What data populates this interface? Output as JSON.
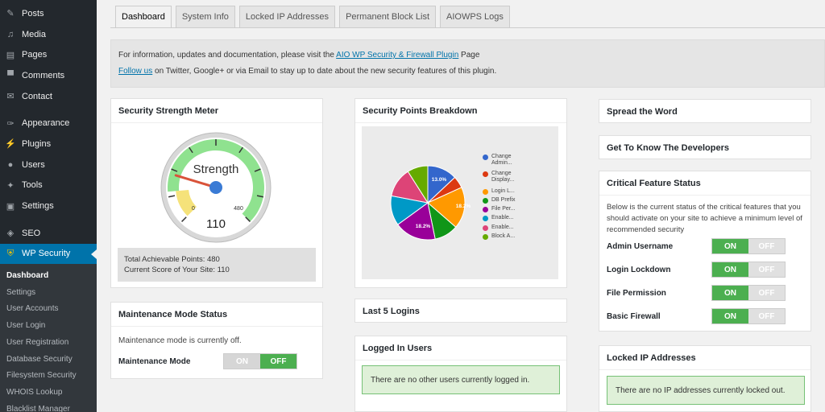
{
  "sidebar": {
    "menu": [
      {
        "label": "Posts",
        "icon": "pin-icon"
      },
      {
        "label": "Media",
        "icon": "media-icon"
      },
      {
        "label": "Pages",
        "icon": "pages-icon"
      },
      {
        "label": "Comments",
        "icon": "comment-icon"
      },
      {
        "label": "Contact",
        "icon": "mail-icon"
      },
      {
        "label": "Appearance",
        "icon": "brush-icon"
      },
      {
        "label": "Plugins",
        "icon": "plug-icon"
      },
      {
        "label": "Users",
        "icon": "user-icon"
      },
      {
        "label": "Tools",
        "icon": "wrench-icon"
      },
      {
        "label": "Settings",
        "icon": "settings-icon"
      },
      {
        "label": "SEO",
        "icon": "seo-icon"
      },
      {
        "label": "WP Security",
        "icon": "shield-icon"
      }
    ],
    "submenu": [
      "Dashboard",
      "Settings",
      "User Accounts",
      "User Login",
      "User Registration",
      "Database Security",
      "Filesystem Security",
      "WHOIS Lookup",
      "Blacklist Manager"
    ]
  },
  "tabs": [
    "Dashboard",
    "System Info",
    "Locked IP Addresses",
    "Permanent Block List",
    "AIOWPS Logs"
  ],
  "info": {
    "line1_pre": "For information, updates and documentation, please visit the ",
    "line1_link": "AIO WP Security & Firewall Plugin",
    "line1_post": " Page",
    "line2_link": "Follow us",
    "line2_post": " on Twitter, Google+ or via Email to stay up to date about the new security features of this plugin."
  },
  "meter": {
    "title": "Security Strength Meter",
    "gauge_label": "Strength",
    "min": "0",
    "max": "480",
    "value": "110",
    "value_num": 110,
    "max_num": 480,
    "total_label": "Total Achievable Points: 480",
    "current_label": "Current Score of Your Site: 110"
  },
  "breakdown": {
    "title": "Security Points Breakdown",
    "legend": [
      {
        "l1": "Change",
        "l2": "Admin...",
        "color": "#3366cc"
      },
      {
        "l1": "Change",
        "l2": "Display...",
        "color": "#dc3912"
      },
      {
        "l1": "Login L...",
        "l2": "",
        "color": "#ff9900"
      },
      {
        "l1": "DB Prefix",
        "l2": "",
        "color": "#109618"
      },
      {
        "l1": "File Per...",
        "l2": "",
        "color": "#990099"
      },
      {
        "l1": "Enable...",
        "l2": "",
        "color": "#0099c6"
      },
      {
        "l1": "Enable...",
        "l2": "",
        "color": "#dd4477"
      },
      {
        "l1": "Block A...",
        "l2": "",
        "color": "#66aa00"
      }
    ],
    "slice_labels": [
      "13.0%",
      "18.2%",
      "18.2%"
    ]
  },
  "chart_data": {
    "type": "pie",
    "categories": [
      "Change Admin...",
      "Change Display...",
      "Login L...",
      "DB Prefix",
      "File Per...",
      "Enable...",
      "Enable...",
      "Block A..."
    ],
    "values": [
      13.0,
      5.2,
      18.2,
      10.4,
      18.2,
      13.0,
      13.0,
      9.0
    ],
    "colors": [
      "#3366cc",
      "#dc3912",
      "#ff9900",
      "#109618",
      "#990099",
      "#0099c6",
      "#dd4477",
      "#66aa00"
    ],
    "title": "Security Points Breakdown"
  },
  "maintenance": {
    "title": "Maintenance Mode Status",
    "text": "Maintenance mode is currently off.",
    "label": "Maintenance Mode",
    "on": "ON",
    "off": "OFF"
  },
  "last_logins": {
    "title": "Last 5 Logins"
  },
  "logged_in": {
    "title": "Logged In Users",
    "notice": "There are no other users currently logged in."
  },
  "spread": {
    "title": "Spread the Word"
  },
  "developers": {
    "title": "Get To Know The Developers"
  },
  "critical": {
    "title": "Critical Feature Status",
    "desc": "Below is the current status of the critical features that you should activate on your site to achieve a minimum level of recommended security",
    "items": [
      {
        "label": "Admin Username",
        "on": "ON",
        "off": "OFF"
      },
      {
        "label": "Login Lockdown",
        "on": "ON",
        "off": "OFF"
      },
      {
        "label": "File Permission",
        "on": "ON",
        "off": "OFF"
      },
      {
        "label": "Basic Firewall",
        "on": "ON",
        "off": "OFF"
      }
    ]
  },
  "locked": {
    "title": "Locked IP Addresses",
    "notice": "There are no IP addresses currently locked out."
  }
}
